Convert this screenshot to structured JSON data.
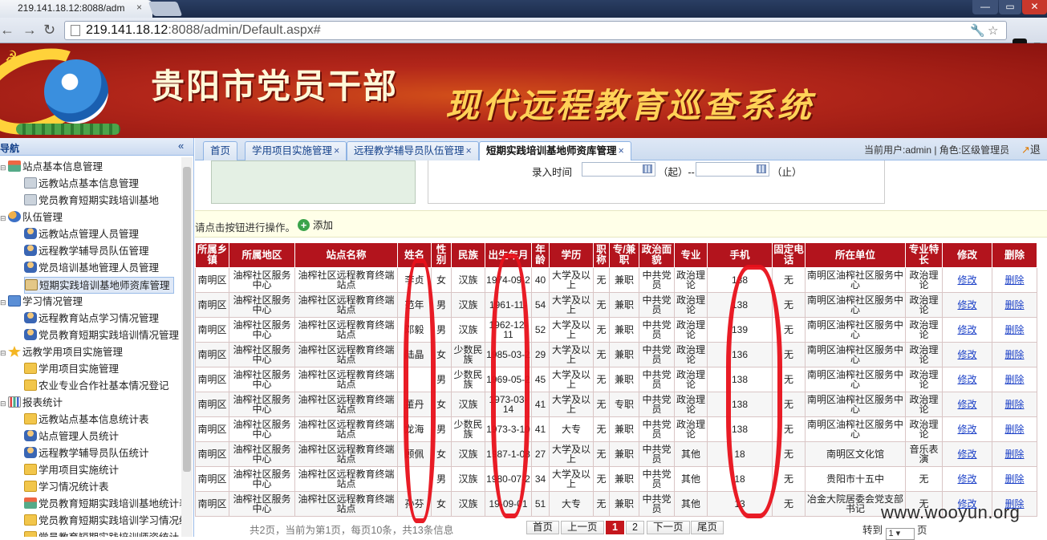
{
  "browser": {
    "tab_title": "219.141.18.12:8088/adm",
    "tab_close": "×",
    "url_host": "219.141.18.12",
    "url_rest": ":8088/admin/Default.aspx#",
    "win_min": "—",
    "win_max": "▭",
    "win_close": "✕",
    "back_icon": "←",
    "forward_icon": "→",
    "reload_icon": "↻",
    "wrench_icon": "🔧",
    "star_icon": "☆",
    "menu_icon": "≡"
  },
  "banner": {
    "title": "贵阳市党员干部",
    "subtitle": "现代远程教育巡查系统"
  },
  "sidebar": {
    "header": "导航",
    "collapse_icon": "«",
    "items": [
      {
        "label": "站点基本信息管理",
        "level": 0,
        "icon": "net"
      },
      {
        "label": "远教站点基本信息管理",
        "level": 1,
        "icon": "house"
      },
      {
        "label": "党员教育短期实践培训基地",
        "level": 1,
        "icon": "house"
      },
      {
        "label": "队伍管理",
        "level": 0,
        "icon": "people"
      },
      {
        "label": "远教站点管理人员管理",
        "level": 1,
        "icon": "person"
      },
      {
        "label": "远程教学辅导员队伍管理",
        "level": 1,
        "icon": "person"
      },
      {
        "label": "党员培训基地管理人员管理",
        "level": 1,
        "icon": "person"
      },
      {
        "label": "短期实践培训基地师资库管理",
        "level": 1,
        "icon": "house2",
        "selected": true
      },
      {
        "label": "学习情况管理",
        "level": 0,
        "icon": "monitor"
      },
      {
        "label": "远程教育站点学习情况管理",
        "level": 1,
        "icon": "person"
      },
      {
        "label": "党员教育短期实践培训情况管理",
        "level": 1,
        "icon": "person"
      },
      {
        "label": "远教学用项目实施管理",
        "level": 0,
        "icon": "star"
      },
      {
        "label": "学用项目实施管理",
        "level": 1,
        "icon": "folder"
      },
      {
        "label": "农业专业合作社基本情况登记",
        "level": 1,
        "icon": "folder"
      },
      {
        "label": "报表统计",
        "level": 0,
        "icon": "chart"
      },
      {
        "label": "远教站点基本信息统计表",
        "level": 1,
        "icon": "folder"
      },
      {
        "label": "站点管理人员统计",
        "level": 1,
        "icon": "person"
      },
      {
        "label": "远程教学辅导员队伍统计",
        "level": 1,
        "icon": "person"
      },
      {
        "label": "学用项目实施统计",
        "level": 1,
        "icon": "folder"
      },
      {
        "label": "学习情况统计表",
        "level": 1,
        "icon": "folder"
      },
      {
        "label": "党员教育短期实践培训基地统计表",
        "level": 1,
        "icon": "net"
      },
      {
        "label": "党员教育短期实践培训学习情况统",
        "level": 1,
        "icon": "folder"
      },
      {
        "label": "党员教育短期实践培训师资统计",
        "level": 1,
        "icon": "folder"
      }
    ]
  },
  "tabs": [
    {
      "label": "首页",
      "closable": false
    },
    {
      "label": "学用项目实施管理",
      "closable": true
    },
    {
      "label": "远程教学辅导员队伍管理",
      "closable": true
    },
    {
      "label": "短期实践培训基地师资库管理",
      "closable": true,
      "active": true
    }
  ],
  "tab_close": "×",
  "user_info": "当前用户:admin | 角色:区级管理员",
  "logout_label": "退",
  "logout_icon": "↗",
  "filter": {
    "entry_time_label": "录入时间",
    "from_label": "（起）--",
    "to_label": "（止）"
  },
  "hint": {
    "text": "请点击按钮进行操作。",
    "add_label": "添加",
    "add_icon": "+"
  },
  "table": {
    "headers": [
      "所属乡镇",
      "所属地区",
      "站点名称",
      "姓名",
      "性别",
      "民族",
      "出生年月",
      "年龄",
      "学历",
      "职称",
      "专/兼职",
      "政治面貌",
      "专业",
      "手机",
      "固定电话",
      "所在单位",
      "专业特长",
      "修改",
      "删除"
    ],
    "rows": [
      [
        "南明区",
        "油榨社区服务中心",
        "油榨社区远程教育终端站点",
        "李贞",
        "女",
        "汉族",
        "1974-09-2",
        "40",
        "大学及以上",
        "无",
        "兼职",
        "中共党员",
        "政治理论",
        "138",
        "无",
        "南明区油榨社区服务中心",
        "政治理论",
        "修改",
        "删除"
      ],
      [
        "南明区",
        "油榨社区服务中心",
        "油榨社区远程教育终端站点",
        "范年",
        "男",
        "汉族",
        "1961-11-",
        "54",
        "大学及以上",
        "无",
        "兼职",
        "中共党员",
        "政治理论",
        "138",
        "无",
        "南明区油榨社区服务中心",
        "政治理论",
        "修改",
        "删除"
      ],
      [
        "南明区",
        "油榨社区服务中心",
        "油榨社区远程教育终端站点",
        "邓毅",
        "男",
        "汉族",
        "1962-12-11",
        "52",
        "大学及以上",
        "无",
        "兼职",
        "中共党员",
        "政治理论",
        "139",
        "无",
        "南明区油榨社区服务中心",
        "政治理论",
        "修改",
        "删除"
      ],
      [
        "南明区",
        "油榨社区服务中心",
        "油榨社区远程教育终端站点",
        "陆晶",
        "女",
        "少数民族",
        "1985-03-2",
        "29",
        "大学及以上",
        "无",
        "兼职",
        "中共党员",
        "政治理论",
        "136",
        "无",
        "南明区油榨社区服务中心",
        "政治理论",
        "修改",
        "删除"
      ],
      [
        "南明区",
        "油榨社区服务中心",
        "油榨社区远程教育终端站点",
        "",
        "男",
        "少数民族",
        "1969-05-2",
        "45",
        "大学及以上",
        "无",
        "兼职",
        "中共党员",
        "政治理论",
        "138",
        "无",
        "南明区油榨社区服务中心",
        "政治理论",
        "修改",
        "删除"
      ],
      [
        "南明区",
        "油榨社区服务中心",
        "油榨社区远程教育终端站点",
        "董丹",
        "女",
        "汉族",
        "1973-03-14",
        "41",
        "大学及以上",
        "无",
        "专职",
        "中共党员",
        "政治理论",
        "138",
        "无",
        "南明区油榨社区服务中心",
        "政治理论",
        "修改",
        "删除"
      ],
      [
        "南明区",
        "油榨社区服务中心",
        "油榨社区远程教育终端站点",
        "龙海",
        "男",
        "少数民族",
        "1973-3-10",
        "41",
        "大专",
        "无",
        "兼职",
        "中共党员",
        "政治理论",
        "138",
        "无",
        "南明区油榨社区服务中心",
        "政治理论",
        "修改",
        "删除"
      ],
      [
        "南明区",
        "油榨社区服务中心",
        "油榨社区远程教育终端站点",
        "顾佩",
        "女",
        "汉族",
        "1987-1-08",
        "27",
        "大学及以上",
        "无",
        "兼职",
        "中共党员",
        "其他",
        "18",
        "无",
        "南明区文化馆",
        "音乐表演",
        "修改",
        "删除"
      ],
      [
        "南明区",
        "油榨社区服务中心",
        "油榨社区远程教育终端站点",
        "",
        "男",
        "汉族",
        "1980-07-2",
        "34",
        "大学及以上",
        "无",
        "兼职",
        "中共党员",
        "其他",
        "18",
        "无",
        "贵阳市十五中",
        "无",
        "修改",
        "删除"
      ],
      [
        "南明区",
        "油榨社区服务中心",
        "油榨社区远程教育终端站点",
        "孙芬",
        "女",
        "汉族",
        "19-09-01",
        "51",
        "大专",
        "无",
        "兼职",
        "中共党员",
        "其他",
        "13",
        "无",
        "冶金大院居委会党支部书记",
        "无",
        "修改",
        "删除"
      ]
    ]
  },
  "pager": {
    "info": "共2页，当前为第1页，每页10条，共13条信息",
    "first": "首页",
    "prev": "上一页",
    "page1": "1",
    "page2": "2",
    "next": "下一页",
    "last": "尾页",
    "goto_label": "转到",
    "goto_value": "1 ▾",
    "goto_suffix": "页"
  },
  "watermark": "www.wooyun.org"
}
